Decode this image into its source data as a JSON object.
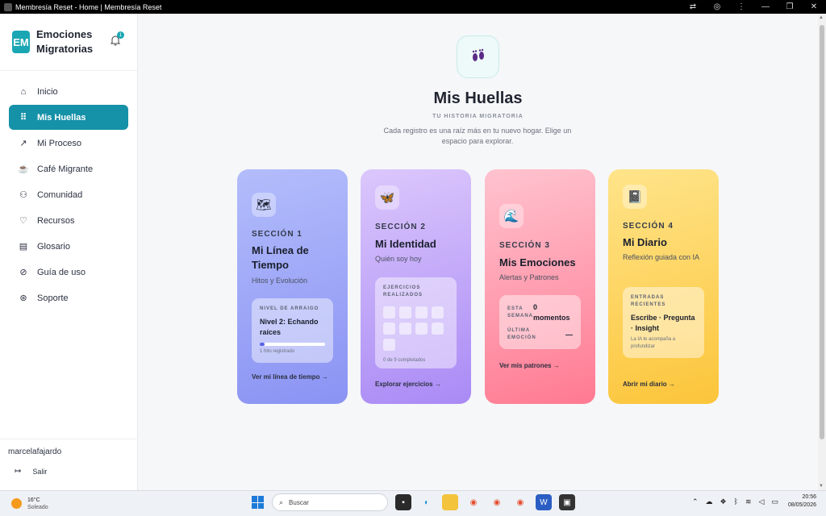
{
  "window": {
    "title": "Membresía Reset - Home | Membresía Reset",
    "min": "—",
    "max": "❐",
    "close": "✕"
  },
  "sidebar": {
    "brand_logo": "EM",
    "brand_name": "Emociones Migratorias",
    "notifications": "1",
    "items": [
      {
        "label": "Inicio",
        "icon": "home-icon",
        "glyph": "⌂"
      },
      {
        "label": "Mis Huellas",
        "icon": "footprints-icon",
        "glyph": "⠿"
      },
      {
        "label": "Mi Proceso",
        "icon": "trending-up-icon",
        "glyph": "↗"
      },
      {
        "label": "Café Migrante",
        "icon": "coffee-icon",
        "glyph": "☕"
      },
      {
        "label": "Comunidad",
        "icon": "users-icon",
        "glyph": "⚇"
      },
      {
        "label": "Recursos",
        "icon": "heart-hand-icon",
        "glyph": "♡"
      },
      {
        "label": "Glosario",
        "icon": "book-icon",
        "glyph": "▤"
      },
      {
        "label": "Guía de uso",
        "icon": "compass-icon",
        "glyph": "⊘"
      },
      {
        "label": "Soporte",
        "icon": "lifebuoy-icon",
        "glyph": "⊛"
      }
    ],
    "username": "marcelafajardo",
    "logout": "Salir"
  },
  "header": {
    "title": "Mis Huellas",
    "kicker": "TU HISTORIA MIGRATORIA",
    "subtitle": "Cada registro es una raíz más en tu nuevo hogar. Elige un espacio para explorar."
  },
  "cards": [
    {
      "section": "SECCIÓN 1",
      "title": "Mi Línea de Tiempo",
      "subtitle": "Hitos y Evolución",
      "emoji": "🗺",
      "box_label": "NIVEL DE ARRAIGO",
      "box_value": "Nivel 2: Echando raíces",
      "progress": 0.08,
      "box_note": "1 hito registrado",
      "cta": "Ver mi línea de tiempo →"
    },
    {
      "section": "SECCIÓN 2",
      "title": "Mi Identidad",
      "subtitle": "Quién soy hoy",
      "emoji": "🦋",
      "box_label": "EJERCICIOS REALIZADOS",
      "box_note": "0 de 9 completados",
      "completed": 0,
      "total": 9,
      "cta": "Explorar ejercicios →"
    },
    {
      "section": "SECCIÓN 3",
      "title": "Mis Emociones",
      "subtitle": "Alertas y Patrones",
      "emoji": "🌊",
      "row1_label": "ESTA SEMANA",
      "row1_value": "0 momentos",
      "row2_label": "ÚLTIMA EMOCIÓN",
      "row2_value": "—",
      "cta": "Ver mis patrones →"
    },
    {
      "section": "SECCIÓN 4",
      "title": "Mi Diario",
      "subtitle": "Reflexión guiada con IA",
      "emoji": "📓",
      "box_label": "ENTRADAS RECIENTES",
      "box_value": "Escribe · Pregunta · Insight",
      "box_note": "La IA te acompaña a profundizar",
      "cta": "Abrir mi diario →"
    }
  ],
  "taskbar": {
    "temp": "16°C",
    "weather": "Soleado",
    "search_placeholder": "Buscar",
    "time": "20:56",
    "date": "08/05/2026"
  }
}
